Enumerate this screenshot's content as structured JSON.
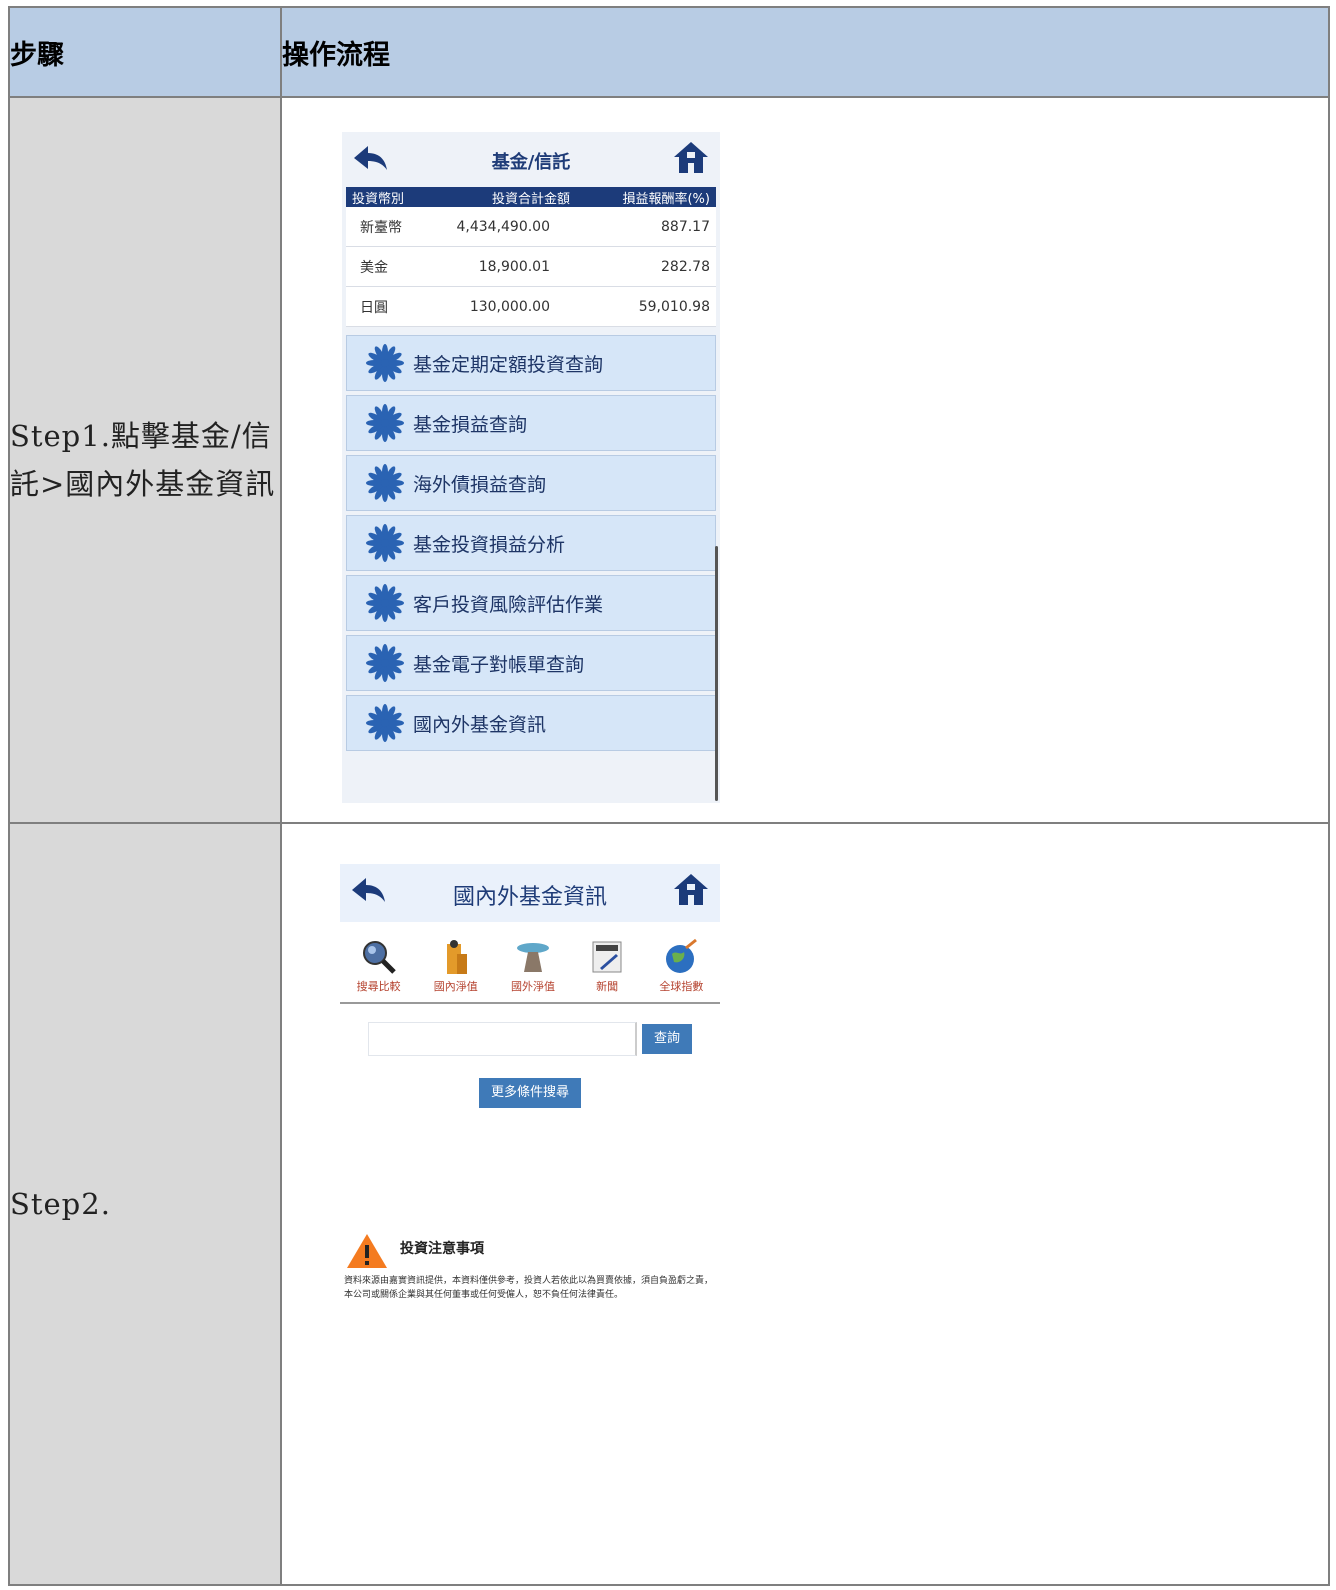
{
  "header": {
    "col1": "步驟",
    "col2": "操作流程"
  },
  "step1": {
    "label": "Step1.點擊基金/信託>國內外基金資訊",
    "screen": {
      "title": "基金/信託",
      "table_headers": [
        "投資幣別",
        "投資合計金額",
        "損益報酬率(%)"
      ],
      "rows": [
        [
          "新臺幣",
          "4,434,490.00",
          "887.17"
        ],
        [
          "美金",
          "18,900.01",
          "282.78"
        ],
        [
          "日圓",
          "130,000.00",
          "59,010.98"
        ]
      ],
      "menu": [
        "基金定期定額投資查詢",
        "基金損益查詢",
        "海外債損益查詢",
        "基金投資損益分析",
        "客戶投資風險評估作業",
        "基金電子對帳單查詢",
        "國內外基金資訊"
      ]
    }
  },
  "step2": {
    "label": "Step2.",
    "screen": {
      "title": "國內外基金資訊",
      "tabs": [
        "搜尋比較",
        "國內淨值",
        "國外淨值",
        "新聞",
        "全球指數"
      ],
      "query_button": "查詢",
      "more_button": "更多條件搜尋",
      "notice_title": "投資注意事項",
      "notice_text": "資料來源由嘉實資訊提供，本資料僅供參考，投資人若依此以為買賣依據，須自負盈虧之責，本公司或關係企業與其任何董事或任何受僱人，恕不負任何法律責任。"
    }
  },
  "colors": {
    "header_bg": "#b8cce4",
    "step_bg": "#d9d9d9",
    "accent": "#1c3b7a",
    "button": "#3f7ab8"
  }
}
